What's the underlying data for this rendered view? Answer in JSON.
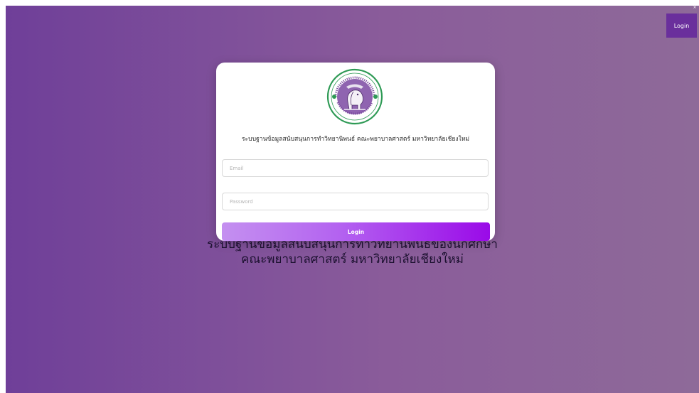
{
  "header": {
    "login_label": "Login",
    "close_glyph": "×"
  },
  "background": {
    "title_line1": "ระบบฐานข้อมูลสนับสนุนการทำวิทยานิพนธ์ของนักศึกษา",
    "title_line2": "คณะพยาบาลศาสตร์ มหาวิทยาลัยเชียงใหม่",
    "gradient_start": "#6f3f99",
    "gradient_end": "#8e6a99"
  },
  "modal": {
    "logo_icon": "cmu-elephant-seal",
    "subtitle": "ระบบฐานข้อมูลสนับสนุนการทำวิทยานิพนธ์ คณะพยาบาลศาสตร์ มหาวิทยาลัยเชียงใหม่",
    "email_placeholder": "Email",
    "password_placeholder": "Password",
    "login_label": "Login",
    "button_gradient": [
      "#c490f0",
      "#9a0ae8"
    ]
  }
}
